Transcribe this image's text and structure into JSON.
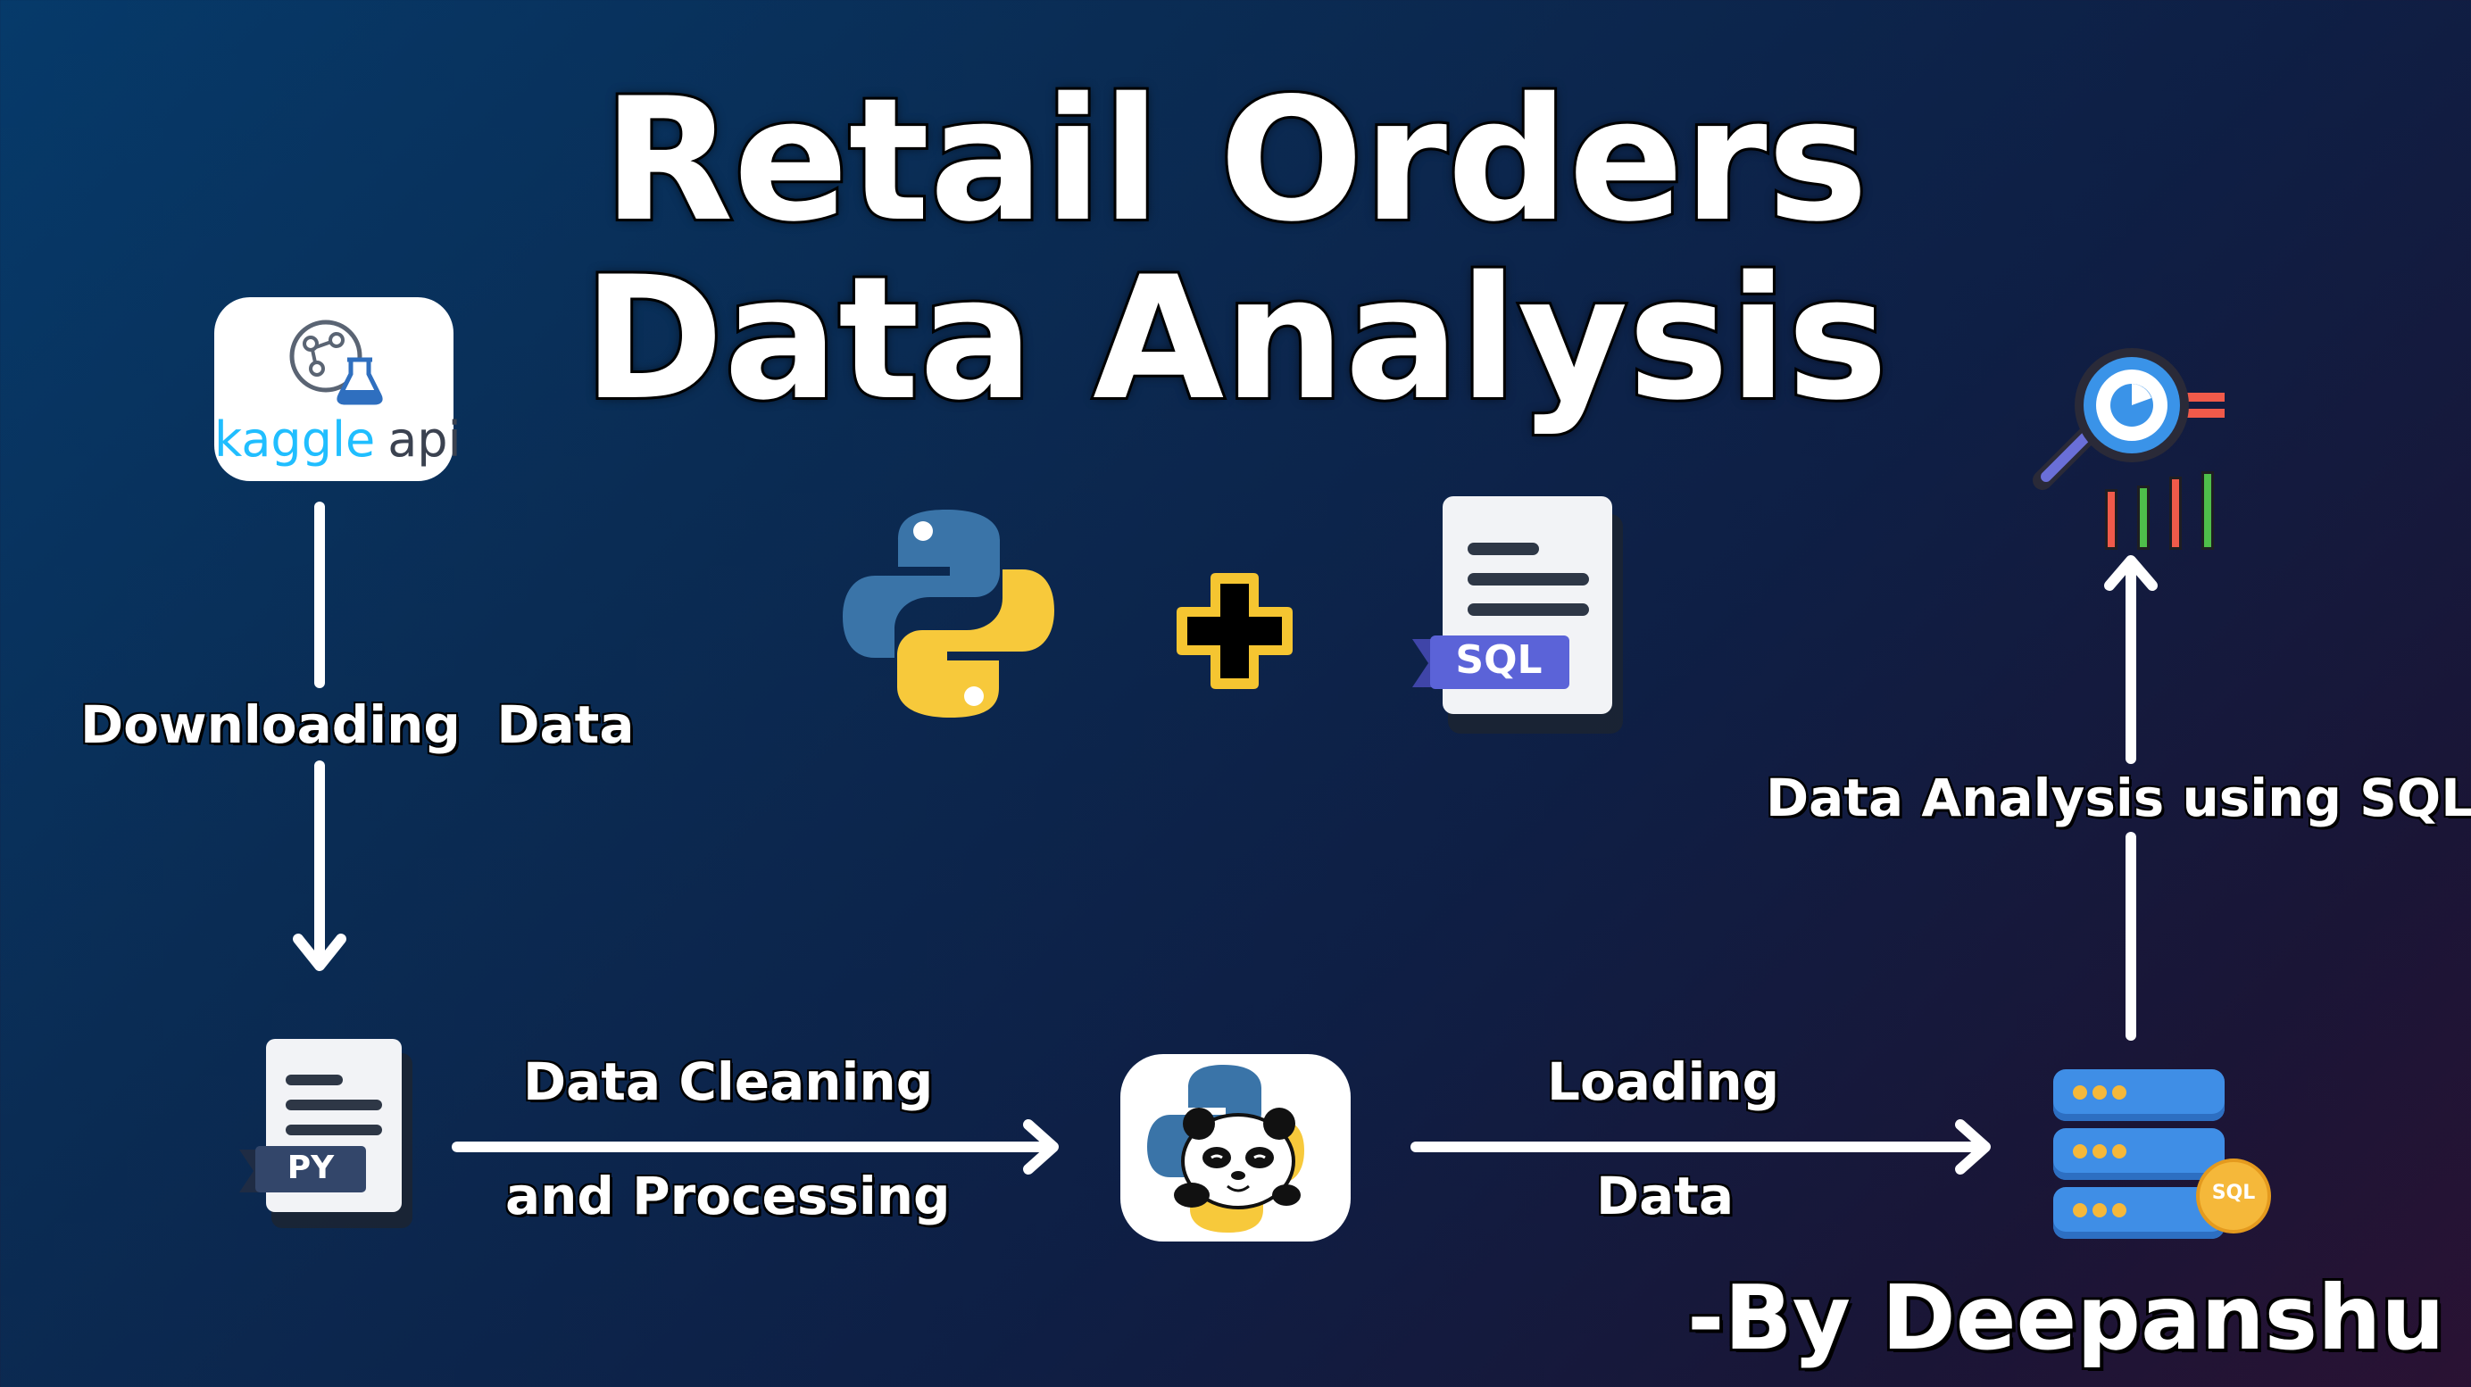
{
  "title": {
    "line1": "Retail Orders",
    "line2": "Data Analysis"
  },
  "nodes": {
    "kaggle": {
      "brand": "kaggle",
      "suffix": "api"
    },
    "py_file": {
      "tag": "PY"
    },
    "sql_file": {
      "tag": "SQL"
    },
    "sql_db": {
      "tag": "SQL"
    }
  },
  "edges": {
    "downloading": "Downloading  Data",
    "cleaning_line1": "Data Cleaning",
    "cleaning_line2": "and Processing",
    "loading_line1": "Loading",
    "loading_line2": "Data",
    "analysis": "Data Analysis using SQL"
  },
  "author": "-By Deepanshu",
  "colors": {
    "python_blue": "#3a74a8",
    "python_yellow": "#f7c93b",
    "plus_yellow": "#f5c531",
    "sql_tag": "#5b63d8",
    "db_blue": "#3f8ee6",
    "db_dot": "#f5b83a",
    "kaggle_blue": "#20beff"
  }
}
